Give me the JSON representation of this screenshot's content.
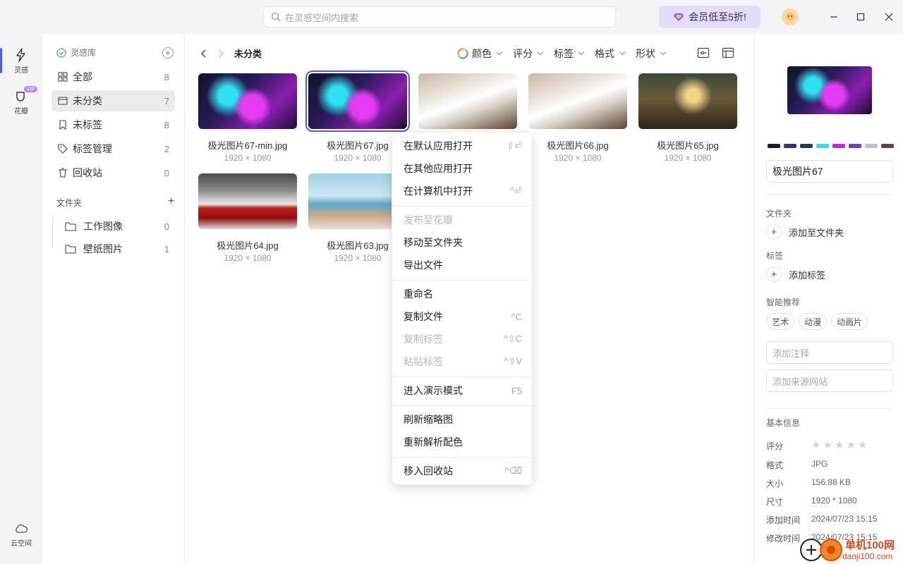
{
  "topbar": {
    "search_placeholder": "在灵感空间内搜索",
    "vip_label": "会员低至5折!"
  },
  "rail": {
    "inspiration": "灵感",
    "huaban": "花瓣",
    "vip_badge": "VIP",
    "cloud": "云空间"
  },
  "sidebar": {
    "library": "灵感库",
    "items": [
      {
        "label": "全部",
        "count": "8"
      },
      {
        "label": "未分类",
        "count": "7"
      },
      {
        "label": "未标签",
        "count": "8"
      },
      {
        "label": "标签管理",
        "count": "2"
      },
      {
        "label": "回收站",
        "count": "0"
      }
    ],
    "folder_header": "文件夹",
    "folders": [
      {
        "label": "工作图像",
        "count": "0"
      },
      {
        "label": "壁纸图片",
        "count": "1"
      }
    ]
  },
  "main": {
    "title": "未分类",
    "filters": [
      "颜色",
      "评分",
      "标签",
      "格式",
      "形状"
    ],
    "items": [
      {
        "name": "极光图片67-min.jpg",
        "dim": "1920 × 1080"
      },
      {
        "name": "极光图片67.jpg",
        "dim": "1920 × 1080"
      },
      {
        "name": "",
        "dim": ""
      },
      {
        "name": "极光图片66.jpg",
        "dim": "1920 × 1080"
      },
      {
        "name": "极光图片65.jpg",
        "dim": "1920 × 1080"
      },
      {
        "name": "极光图片64.jpg",
        "dim": "1920 × 1080"
      },
      {
        "name": "极光图片63.jpg",
        "dim": "1920 × 1080"
      }
    ]
  },
  "context_menu": {
    "items": [
      {
        "label": "在默认应用打开",
        "shortcut": "⇧⏎"
      },
      {
        "label": "在其他应用打开",
        "shortcut": ""
      },
      {
        "label": "在计算机中打开",
        "shortcut": "^⏎"
      },
      {
        "label": "发布至花瓣",
        "shortcut": ""
      },
      {
        "label": "移动至文件夹",
        "shortcut": ""
      },
      {
        "label": "导出文件",
        "shortcut": ""
      },
      {
        "label": "重命名",
        "shortcut": ""
      },
      {
        "label": "复制文件",
        "shortcut": "^C"
      },
      {
        "label": "复制标签",
        "shortcut": "^⇧C"
      },
      {
        "label": "粘贴标签",
        "shortcut": "^⇧V"
      },
      {
        "label": "进入演示模式",
        "shortcut": "F5"
      },
      {
        "label": "刷新缩略图",
        "shortcut": ""
      },
      {
        "label": "重新解析配色",
        "shortcut": ""
      },
      {
        "label": "移入回收站",
        "shortcut": "^⌫"
      }
    ]
  },
  "right_panel": {
    "palette": [
      "#1c1c2e",
      "#3c2f7a",
      "#2a3560",
      "#3fd3e6",
      "#c12ad0",
      "#6a3fc0",
      "#c6b9d6",
      "#5a4a3a"
    ],
    "file_name": "极光图片67",
    "folder_label": "文件夹",
    "add_folder": "添加至文件夹",
    "tag_label": "标签",
    "add_tag": "添加标签",
    "smart_label": "智能推荐",
    "smart_tags": [
      "艺术",
      "动漫",
      "动画片"
    ],
    "note_placeholder": "添加注释",
    "source_placeholder": "添加来源网站",
    "basic_info": "基本信息",
    "rating_label": "评分",
    "rating_value": 0,
    "format_label": "格式",
    "format_value": "JPG",
    "size_label": "大小",
    "size_value": "156.88 KB",
    "dim_label": "尺寸",
    "dim_value": "1920 * 1080",
    "added_label": "添加时间",
    "added_value": "2024/07/23 15:15",
    "modified_label": "修改时间",
    "modified_value": "2024/07/23 15:15"
  },
  "watermark": {
    "line1": "单机100网",
    "line2": "danji100.com"
  }
}
